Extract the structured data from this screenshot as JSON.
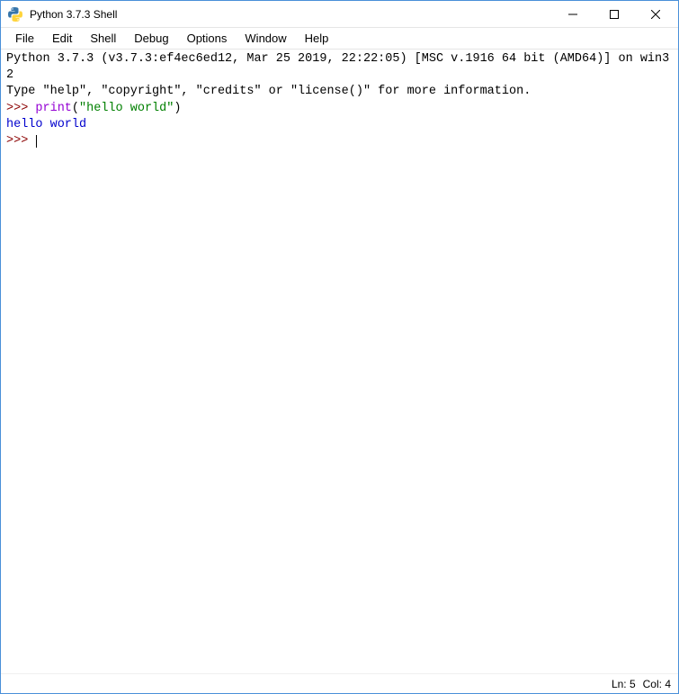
{
  "titlebar": {
    "title": "Python 3.7.3 Shell"
  },
  "menubar": {
    "items": [
      "File",
      "Edit",
      "Shell",
      "Debug",
      "Options",
      "Window",
      "Help"
    ]
  },
  "console": {
    "banner_line1": "Python 3.7.3 (v3.7.3:ef4ec6ed12, Mar 25 2019, 22:22:05) [MSC v.1916 64 bit (AMD64)] on win32",
    "banner_line2": "Type \"help\", \"copyright\", \"credits\" or \"license()\" for more information.",
    "prompt": ">>> ",
    "input_call": "print",
    "input_paren_open": "(",
    "input_string": "\"hello world\"",
    "input_paren_close": ")",
    "output": "hello world"
  },
  "statusbar": {
    "line": "Ln: 5",
    "col": "Col: 4"
  }
}
